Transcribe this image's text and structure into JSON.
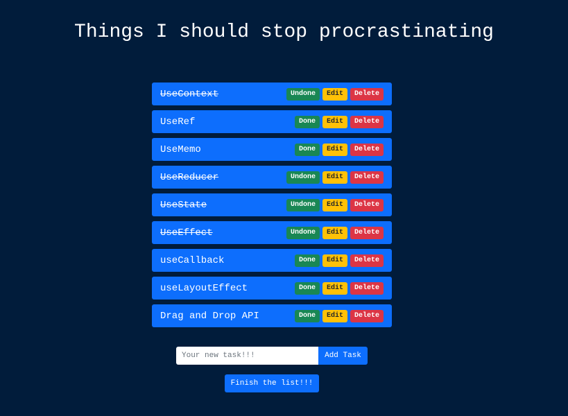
{
  "header": {
    "title": "Things I should stop procrastinating"
  },
  "tasks": [
    {
      "text": "UseContext",
      "done": true,
      "toggle_label": "Undone",
      "edit_label": "Edit",
      "delete_label": "Delete"
    },
    {
      "text": "UseRef",
      "done": false,
      "toggle_label": "Done",
      "edit_label": "Edit",
      "delete_label": "Delete"
    },
    {
      "text": "UseMemo",
      "done": false,
      "toggle_label": "Done",
      "edit_label": "Edit",
      "delete_label": "Delete"
    },
    {
      "text": "UseReducer",
      "done": true,
      "toggle_label": "Undone",
      "edit_label": "Edit",
      "delete_label": "Delete"
    },
    {
      "text": "UseState",
      "done": true,
      "toggle_label": "Undone",
      "edit_label": "Edit",
      "delete_label": "Delete"
    },
    {
      "text": "UseEffect",
      "done": true,
      "toggle_label": "Undone",
      "edit_label": "Edit",
      "delete_label": "Delete"
    },
    {
      "text": "useCallback",
      "done": false,
      "toggle_label": "Done",
      "edit_label": "Edit",
      "delete_label": "Delete"
    },
    {
      "text": "useLayoutEffect",
      "done": false,
      "toggle_label": "Done",
      "edit_label": "Edit",
      "delete_label": "Delete"
    },
    {
      "text": "Drag and Drop API",
      "done": false,
      "toggle_label": "Done",
      "edit_label": "Edit",
      "delete_label": "Delete"
    }
  ],
  "add_form": {
    "input_value": "",
    "input_placeholder": "Your new task!!!",
    "add_button_label": "Add Task"
  },
  "finish_button_label": "Finish the list!!!",
  "colors": {
    "background": "#011c3b",
    "task_bg": "#0d6efd",
    "done_button": "#198754",
    "edit_button": "#ffc107",
    "delete_button": "#dc3545"
  }
}
